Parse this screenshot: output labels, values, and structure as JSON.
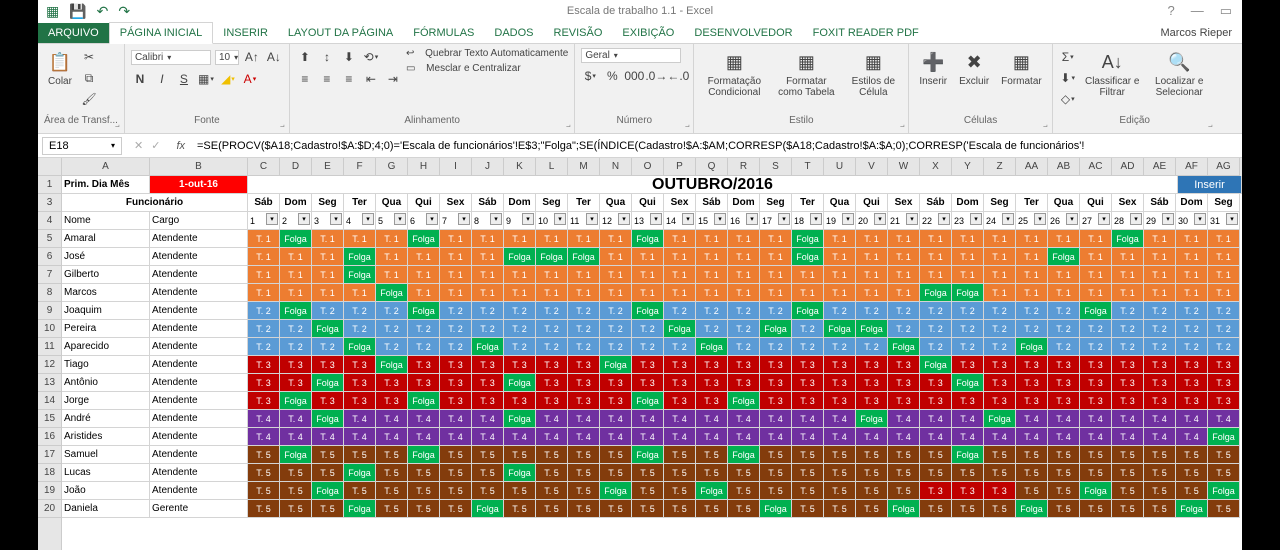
{
  "window": {
    "title": "Escala de trabalho 1.1 - Excel",
    "user": "Marcos Rieper"
  },
  "tabs": {
    "file": "ARQUIVO",
    "items": [
      "PÁGINA INICIAL",
      "INSERIR",
      "LAYOUT DA PÁGINA",
      "FÓRMULAS",
      "DADOS",
      "REVISÃO",
      "EXIBIÇÃO",
      "DESENVOLVEDOR",
      "FOXIT READER PDF"
    ],
    "active": 0
  },
  "ribbon": {
    "clipboard": {
      "label": "Área de Transf...",
      "paste": "Colar"
    },
    "font": {
      "label": "Fonte",
      "name": "Calibri",
      "size": "10"
    },
    "alignment": {
      "label": "Alinhamento",
      "wrap": "Quebrar Texto Automaticamente",
      "merge": "Mesclar e Centralizar"
    },
    "number": {
      "label": "Número",
      "format": "Geral"
    },
    "styles": {
      "label": "Estilo",
      "cond": "Formatação Condicional",
      "table": "Formatar como Tabela",
      "cell": "Estilos de Célula"
    },
    "cells": {
      "label": "Células",
      "insert": "Inserir",
      "delete": "Excluir",
      "format": "Formatar"
    },
    "editing": {
      "label": "Edição",
      "sort": "Classificar e Filtrar",
      "find": "Localizar e Selecionar"
    }
  },
  "formula_bar": {
    "cell_ref": "E18",
    "formula": "=SE(PROCV($A18;Cadastro!$A:$D;4;0)='Escala de funcionários'!E$3;\"Folga\";SE(ÍNDICE(Cadastro!$A:$AM;CORRESP($A18;Cadastro!$A:$A;0);CORRESP('Escala de funcionários'!"
  },
  "columns": [
    "A",
    "B",
    "C",
    "D",
    "E",
    "F",
    "G",
    "H",
    "I",
    "J",
    "K",
    "L",
    "M",
    "N",
    "O",
    "P",
    "Q",
    "R",
    "S",
    "T",
    "U",
    "V",
    "W",
    "X",
    "Y",
    "Z",
    "AA",
    "AB",
    "AC",
    "AD",
    "AE",
    "AF",
    "AG"
  ],
  "rows": [
    "1",
    "3",
    "4",
    "5",
    "6",
    "7",
    "8",
    "9",
    "10",
    "11",
    "12",
    "13",
    "14",
    "15",
    "16",
    "17",
    "18",
    "19",
    "20"
  ],
  "sheet": {
    "a1": "Prim. Dia Mês",
    "b1": "1-out-16",
    "title": "OUTUBRO/2016",
    "inserir": "Inserir",
    "funcionario": "Funcionário",
    "nome": "Nome",
    "cargo": "Cargo",
    "weekdays": [
      "Sáb",
      "Dom",
      "Seg",
      "Ter",
      "Qua",
      "Qui",
      "Sex",
      "Sáb",
      "Dom",
      "Seg",
      "Ter",
      "Qua",
      "Qui",
      "Sex",
      "Sáb",
      "Dom",
      "Seg",
      "Ter",
      "Qua",
      "Qui",
      "Sex",
      "Sáb",
      "Dom",
      "Seg",
      "Ter",
      "Qua",
      "Qui",
      "Sex",
      "Sáb",
      "Dom",
      "Seg"
    ],
    "daynums": [
      "1",
      "2",
      "3",
      "4",
      "5",
      "6",
      "7",
      "8",
      "9",
      "10",
      "11",
      "12",
      "13",
      "14",
      "15",
      "16",
      "17",
      "18",
      "19",
      "20",
      "21",
      "22",
      "23",
      "24",
      "25",
      "26",
      "27",
      "28",
      "29",
      "30",
      "31"
    ]
  },
  "people": [
    {
      "n": 5,
      "nome": "Amaral",
      "cargo": "Atendente"
    },
    {
      "n": 6,
      "nome": "José",
      "cargo": "Atendente"
    },
    {
      "n": 7,
      "nome": "Gilberto",
      "cargo": "Atendente"
    },
    {
      "n": 8,
      "nome": "Marcos",
      "cargo": "Atendente"
    },
    {
      "n": 9,
      "nome": "Joaquim",
      "cargo": "Atendente"
    },
    {
      "n": 10,
      "nome": "Pereira",
      "cargo": "Atendente"
    },
    {
      "n": 11,
      "nome": "Aparecido",
      "cargo": "Atendente"
    },
    {
      "n": 12,
      "nome": "Tiago",
      "cargo": "Atendente"
    },
    {
      "n": 13,
      "nome": "Antônio",
      "cargo": "Atendente"
    },
    {
      "n": 14,
      "nome": "Jorge",
      "cargo": "Atendente"
    },
    {
      "n": 15,
      "nome": "André",
      "cargo": "Atendente"
    },
    {
      "n": 16,
      "nome": "Aristides",
      "cargo": "Atendente"
    },
    {
      "n": 17,
      "nome": "Samuel",
      "cargo": "Atendente"
    },
    {
      "n": 18,
      "nome": "Lucas",
      "cargo": "Atendente"
    },
    {
      "n": 19,
      "nome": "João",
      "cargo": "Atendente"
    },
    {
      "n": 20,
      "nome": "Daniela",
      "cargo": "Gerente"
    }
  ],
  "labels": {
    "folga": "Folga",
    "t1": "T. 1",
    "t2": "T. 2",
    "t3": "T. 3",
    "t4": "T. 4",
    "t5": "T. 5"
  },
  "schedule": [
    [
      "t1",
      "folga",
      "t1",
      "t1",
      "t1",
      "folga",
      "t1",
      "t1",
      "t1",
      "t1",
      "t1",
      "t1",
      "folga",
      "t1",
      "t1",
      "t1",
      "t1",
      "folga",
      "t1",
      "t1",
      "t1",
      "t1",
      "t1",
      "t1",
      "t1",
      "t1",
      "t1",
      "folga",
      "t1",
      "t1",
      "t1"
    ],
    [
      "t1",
      "t1",
      "t1",
      "folga",
      "t1",
      "t1",
      "t1",
      "t1",
      "folga",
      "folga",
      "folga",
      "t1",
      "t1",
      "t1",
      "t1",
      "t1",
      "t1",
      "folga",
      "t1",
      "t1",
      "t1",
      "t1",
      "t1",
      "t1",
      "t1",
      "folga",
      "t1",
      "t1",
      "t1",
      "t1",
      "t1"
    ],
    [
      "t1",
      "t1",
      "t1",
      "folga",
      "t1",
      "t1",
      "t1",
      "t1",
      "t1",
      "t1",
      "t1",
      "t1",
      "t1",
      "t1",
      "t1",
      "t1",
      "t1",
      "t1",
      "t1",
      "t1",
      "t1",
      "t1",
      "t1",
      "t1",
      "t1",
      "t1",
      "t1",
      "t1",
      "t1",
      "t1",
      "t1"
    ],
    [
      "t1",
      "t1",
      "t1",
      "t1",
      "folga",
      "t1",
      "t1",
      "t1",
      "t1",
      "t1",
      "t1",
      "t1",
      "t1",
      "t1",
      "t1",
      "t1",
      "t1",
      "t1",
      "t1",
      "t1",
      "t1",
      "folga",
      "folga",
      "t1",
      "t1",
      "t1",
      "t1",
      "t1",
      "t1",
      "t1",
      "t1"
    ],
    [
      "t2",
      "folga",
      "t2",
      "t2",
      "t2",
      "folga",
      "t2",
      "t2",
      "t2",
      "t2",
      "t2",
      "t2",
      "folga",
      "t2",
      "t2",
      "t2",
      "t2",
      "folga",
      "t2",
      "t2",
      "t2",
      "t2",
      "t2",
      "t2",
      "t2",
      "t2",
      "folga",
      "t2",
      "t2",
      "t2",
      "t2"
    ],
    [
      "t2",
      "t2",
      "folga",
      "t2",
      "t2",
      "t2",
      "t2",
      "t2",
      "t2",
      "t2",
      "t2",
      "t2",
      "t2",
      "folga",
      "t2",
      "t2",
      "folga",
      "t2",
      "folga",
      "folga",
      "t2",
      "t2",
      "t2",
      "t2",
      "t2",
      "t2",
      "t2",
      "t2",
      "t2",
      "t2",
      "t2"
    ],
    [
      "t2",
      "t2",
      "t2",
      "folga",
      "t2",
      "t2",
      "t2",
      "folga",
      "t2",
      "t2",
      "t2",
      "t2",
      "t2",
      "t2",
      "folga",
      "t2",
      "t2",
      "t2",
      "t2",
      "t2",
      "folga",
      "t2",
      "t2",
      "t2",
      "folga",
      "t2",
      "t2",
      "t2",
      "t2",
      "t2",
      "t2"
    ],
    [
      "t3",
      "t3",
      "t3",
      "t3",
      "folga",
      "t3",
      "t3",
      "t3",
      "t3",
      "t3",
      "t3",
      "folga",
      "t3",
      "t3",
      "t3",
      "t3",
      "t3",
      "t3",
      "t3",
      "t3",
      "t3",
      "folga",
      "t3",
      "t3",
      "t3",
      "t3",
      "t3",
      "t3",
      "t3",
      "t3",
      "t3"
    ],
    [
      "t3",
      "t3",
      "folga",
      "t3",
      "t3",
      "t3",
      "t3",
      "t3",
      "folga",
      "t3",
      "t3",
      "t3",
      "t3",
      "t3",
      "t3",
      "t3",
      "t3",
      "t3",
      "t3",
      "t3",
      "t3",
      "t3",
      "folga",
      "t3",
      "t3",
      "t3",
      "t3",
      "t3",
      "t3",
      "t3",
      "t3"
    ],
    [
      "t3",
      "folga",
      "t3",
      "t3",
      "t3",
      "folga",
      "t3",
      "t3",
      "t3",
      "t3",
      "t3",
      "t3",
      "folga",
      "t3",
      "t3",
      "folga",
      "t3",
      "t3",
      "t3",
      "t3",
      "t3",
      "t3",
      "t3",
      "t3",
      "t3",
      "t3",
      "t3",
      "t3",
      "t3",
      "t3",
      "t3"
    ],
    [
      "t4",
      "t4",
      "folga",
      "t4",
      "t4",
      "t4",
      "t4",
      "t4",
      "folga",
      "t4",
      "t4",
      "t4",
      "t4",
      "t4",
      "t4",
      "t4",
      "t4",
      "t4",
      "t4",
      "folga",
      "t4",
      "t4",
      "t4",
      "folga",
      "t4",
      "t4",
      "t4",
      "t4",
      "t4",
      "t4",
      "t4"
    ],
    [
      "t4",
      "t4",
      "t4",
      "t4",
      "t4",
      "t4",
      "t4",
      "t4",
      "t4",
      "t4",
      "t4",
      "t4",
      "t4",
      "t4",
      "t4",
      "t4",
      "t4",
      "t4",
      "t4",
      "t4",
      "t4",
      "t4",
      "t4",
      "t4",
      "t4",
      "t4",
      "t4",
      "t4",
      "t4",
      "t4",
      "folga"
    ],
    [
      "t5",
      "folga",
      "t5",
      "t5",
      "t5",
      "folga",
      "t5",
      "t5",
      "t5",
      "t5",
      "t5",
      "t5",
      "folga",
      "t5",
      "t5",
      "folga",
      "t5",
      "t5",
      "t5",
      "t5",
      "t5",
      "t5",
      "folga",
      "t5",
      "t5",
      "t5",
      "t5",
      "t5",
      "t5",
      "t5",
      "t5"
    ],
    [
      "t5",
      "t5",
      "t5",
      "folga",
      "t5",
      "t5",
      "t5",
      "t5",
      "folga",
      "t5",
      "t5",
      "t5",
      "t5",
      "t5",
      "t5",
      "t5",
      "t5",
      "t5",
      "t5",
      "t5",
      "t5",
      "t5",
      "t5",
      "t5",
      "t5",
      "t5",
      "t5",
      "t5",
      "t5",
      "t5",
      "t5"
    ],
    [
      "t5",
      "t5",
      "folga",
      "t5",
      "t5",
      "t5",
      "t5",
      "t5",
      "t5",
      "t5",
      "t5",
      "folga",
      "t5",
      "t5",
      "folga",
      "t5",
      "t5",
      "t5",
      "t5",
      "t5",
      "t5",
      "t3",
      "t3",
      "t3",
      "t5",
      "t5",
      "folga",
      "t5",
      "t5",
      "t5",
      "folga"
    ],
    [
      "t5",
      "t5",
      "t5",
      "folga",
      "t5",
      "t5",
      "t5",
      "folga",
      "t5",
      "t5",
      "t5",
      "t5",
      "t5",
      "t5",
      "t5",
      "t5",
      "folga",
      "t5",
      "t5",
      "t5",
      "folga",
      "t5",
      "t5",
      "t5",
      "folga",
      "t5",
      "t5",
      "t5",
      "t5",
      "folga",
      "t5"
    ]
  ]
}
